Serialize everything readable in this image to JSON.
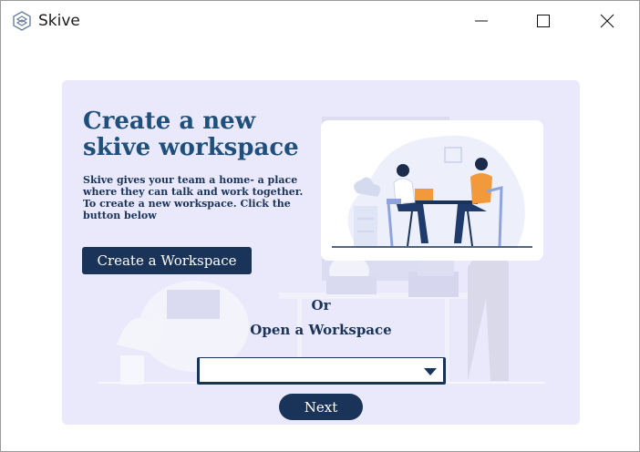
{
  "window": {
    "app_title": "Skive",
    "controls": {
      "minimize": "minimize",
      "maximize": "maximize",
      "close": "close"
    }
  },
  "workspace": {
    "headline": "Create a new skive workspace",
    "description": "Skive gives your team a home- a place where they can talk and work together. To create a new workspace. Click the button below",
    "create_button": "Create a Workspace",
    "or_label": "Or",
    "open_label": "Open a Workspace",
    "select": {
      "value": ""
    },
    "next_button": "Next"
  },
  "icons": {
    "app_logo": "skive-logo-icon",
    "dropdown": "chevron-down-icon"
  },
  "colors": {
    "primary": "#1a3358",
    "headline": "#1f4f7a",
    "panel_bg": "#e9e9fb",
    "accent_orange": "#f29a3b"
  }
}
